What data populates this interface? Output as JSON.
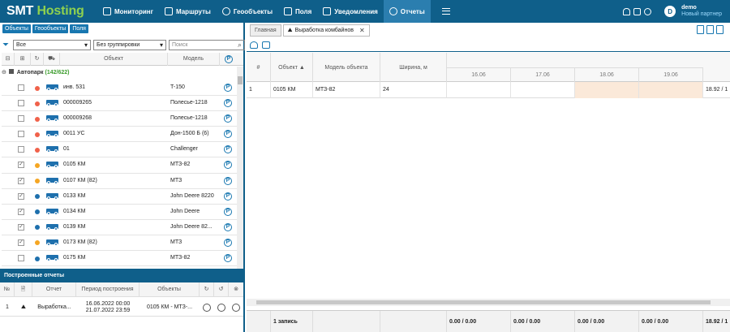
{
  "brand": {
    "part1": "SMT",
    "part2": "Hosting"
  },
  "nav": [
    {
      "label": "Мониторинг",
      "icon": "monitor-icon"
    },
    {
      "label": "Маршруты",
      "icon": "route-icon"
    },
    {
      "label": "Геообъекты",
      "icon": "geo-icon"
    },
    {
      "label": "Поля",
      "icon": "fields-icon"
    },
    {
      "label": "Уведомления",
      "icon": "mail-icon"
    },
    {
      "label": "Отчеты",
      "icon": "reports-icon",
      "active": true
    }
  ],
  "user": {
    "initial": "D",
    "name": "demo",
    "role": "Новый партнер"
  },
  "left": {
    "tabs": [
      "Объекты",
      "Геообъекты",
      "Поля"
    ],
    "filter_all": "Все",
    "grouping": "Без группировки",
    "search_placeholder": "Поиск",
    "col_object": "Объект",
    "col_model": "Модель",
    "park_mark": "P",
    "group": {
      "name": "Автопарк",
      "count": "(142/622)"
    }
  },
  "objects": [
    {
      "name": "инв. 531",
      "model": "T-150",
      "status": "#f0614a",
      "checked": false
    },
    {
      "name": "000009265",
      "model": "Полесье-1218",
      "status": "#f0614a",
      "checked": false
    },
    {
      "name": "000009268",
      "model": "Полесье-1218",
      "status": "#f0614a",
      "checked": false
    },
    {
      "name": "0011 УС",
      "model": "Дон-1500 Б (6)",
      "status": "#f0614a",
      "checked": false
    },
    {
      "name": "01",
      "model": "Challenger",
      "status": "#f0614a",
      "checked": false
    },
    {
      "name": "0105 КМ",
      "model": "МТЗ-82",
      "status": "#f5a623",
      "checked": true
    },
    {
      "name": "0107 КМ (82)",
      "model": "МТЗ",
      "status": "#f5a623",
      "checked": true
    },
    {
      "name": "0133 КМ",
      "model": "John Deere 8220",
      "status": "#1e70ad",
      "checked": true
    },
    {
      "name": "0134 КМ",
      "model": "John Deere",
      "status": "#1e70ad",
      "checked": true
    },
    {
      "name": "0139 КМ",
      "model": "John Deere 82...",
      "status": "#1e70ad",
      "checked": true
    },
    {
      "name": "0173 КМ (82)",
      "model": "МТЗ",
      "status": "#f5a623",
      "checked": true
    },
    {
      "name": "0175 КМ",
      "model": "МТЗ-82",
      "status": "#1e70ad",
      "checked": false
    }
  ],
  "reports": {
    "title": "Построенные отчеты",
    "headers": {
      "num": "№",
      "report": "Отчет",
      "period": "Период построения",
      "objects": "Объекты"
    },
    "rows": [
      {
        "num": "1",
        "report": "Выработка...",
        "period_from": "16.06.2022 00:00",
        "period_to": "21.07.2022 23:59",
        "objects": "0105 КМ - МТЗ-..."
      }
    ]
  },
  "right": {
    "tabs": [
      {
        "label": "Главная"
      },
      {
        "label": "Выработка комбайнов",
        "active": true
      }
    ],
    "table": {
      "headers": {
        "num": "#",
        "object": "Объект ▲",
        "model": "Модель объекта",
        "width": "Ширина, м"
      },
      "dates": [
        "16.06",
        "17.06",
        "18.06",
        "19.06"
      ],
      "row": {
        "num": "1",
        "object": "0105 КМ",
        "model": "МТЗ-82",
        "width": "24",
        "tail": "18.92 / 1"
      },
      "footer": {
        "count": "1 запись",
        "totals": [
          "0.00 / 0.00",
          "0.00 / 0.00",
          "0.00 / 0.00",
          "0.00 / 0.00"
        ],
        "tail": "18.92 / 1"
      }
    }
  }
}
